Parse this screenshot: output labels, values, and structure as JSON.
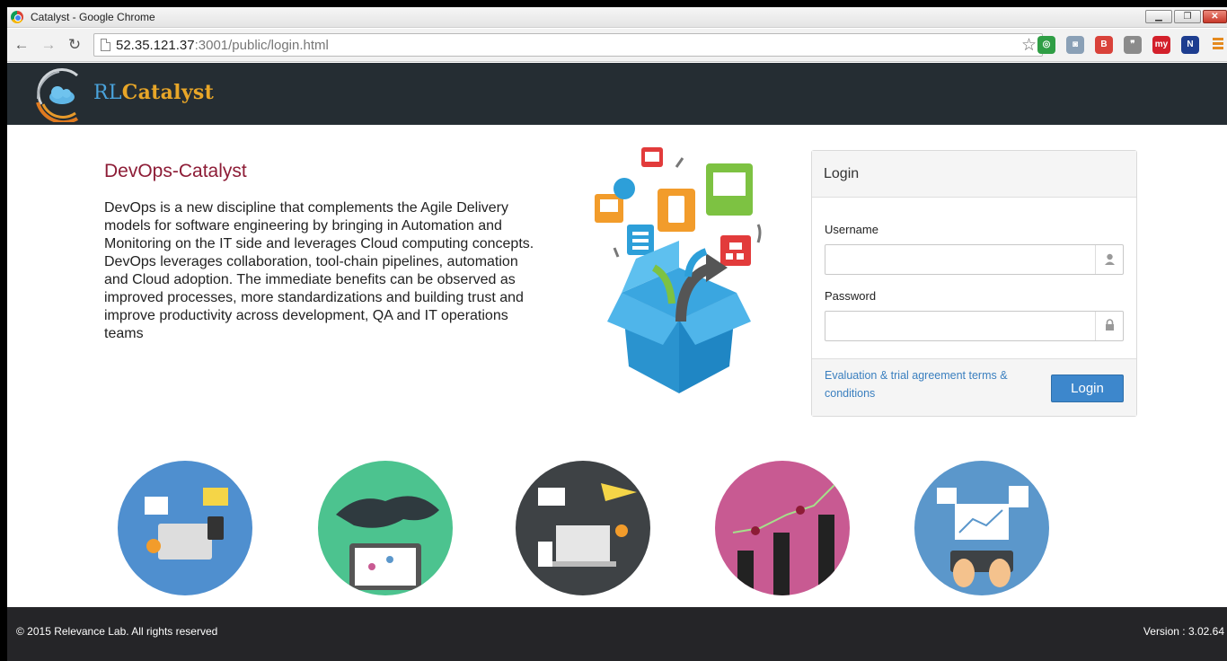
{
  "window": {
    "title": "Catalyst - Google Chrome",
    "minimize": "▁",
    "maximize": "❐",
    "close": "✕"
  },
  "toolbar": {
    "back": "←",
    "forward": "→",
    "reload": "↻",
    "url_host": "52.35.121.37",
    "url_path": ":3001/public/login.html",
    "bookmark_star": "☆"
  },
  "extensions": [
    {
      "name": "search-extension-icon",
      "color": "#2f9e45",
      "glyph": "◎"
    },
    {
      "name": "camera-extension-icon",
      "color": "#8aa0b6",
      "glyph": "◙"
    },
    {
      "name": "b-extension-icon",
      "color": "#d9423a",
      "glyph": "B"
    },
    {
      "name": "chat-extension-icon",
      "color": "#8b8b8b",
      "glyph": "❞"
    },
    {
      "name": "my-extension-icon",
      "color": "#d3202b",
      "glyph": "my"
    },
    {
      "name": "n-extension-icon",
      "color": "#1d3d8f",
      "glyph": "N"
    }
  ],
  "header": {
    "logo_rl": "RL",
    "logo_catalyst": "Catalyst"
  },
  "intro": {
    "title": "DevOps-Catalyst",
    "text": "DevOps is a new discipline that complements the Agile Delivery models for software engineering by bringing in Automation and Monitoring on the IT side and leverages Cloud computing concepts. DevOps leverages collaboration, tool-chain pipelines, automation and Cloud adoption. The immediate benefits can be observed as improved processes, more standardizations and building trust and improve productivity across development, QA and IT operations teams"
  },
  "login": {
    "heading": "Login",
    "username_label": "Username",
    "username_value": "",
    "password_label": "Password",
    "password_value": "",
    "terms_link": "Evaluation & trial agreement terms & conditions",
    "button": "Login"
  },
  "circles": [
    {
      "name": "collaboration-illustration",
      "color": "#4f8fcf"
    },
    {
      "name": "world-map-tablet-illustration",
      "color": "#4cc38f"
    },
    {
      "name": "desk-laptop-illustration",
      "color": "#3e4245"
    },
    {
      "name": "growth-chart-hands-illustration",
      "color": "#c85a92"
    },
    {
      "name": "analytics-keyboard-illustration",
      "color": "#5b97cb"
    }
  ],
  "footer": {
    "copyright": "© 2015 Relevance Lab. All rights reserved",
    "version": "Version : 3.02.64"
  }
}
